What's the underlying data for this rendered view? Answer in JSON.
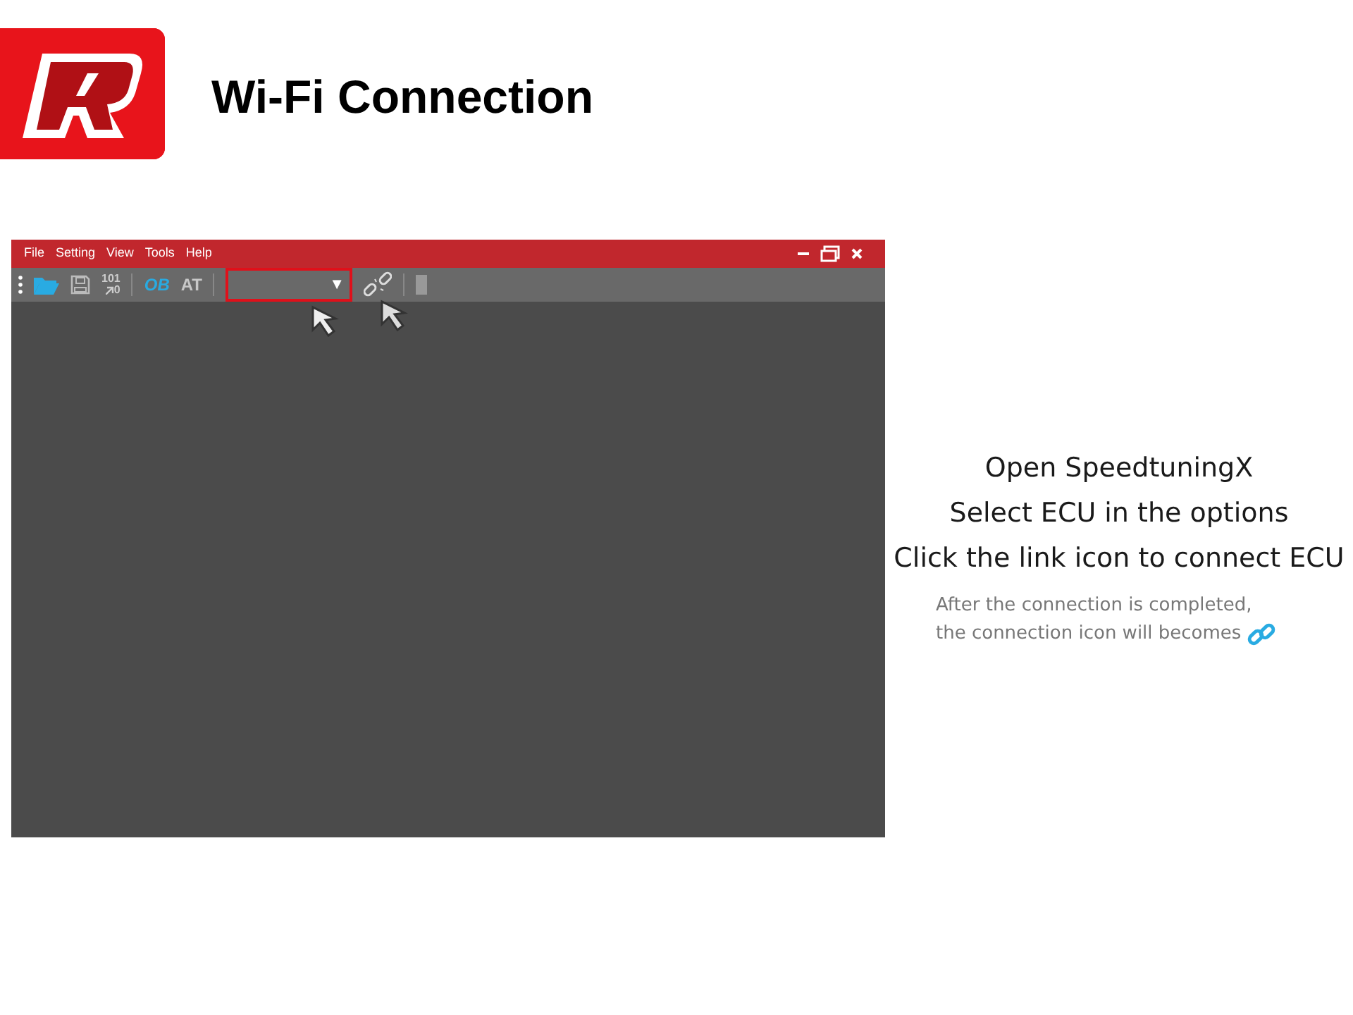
{
  "slide": {
    "title": "Wi-Fi Connection"
  },
  "window": {
    "menu": [
      "File",
      "Setting",
      "View",
      "Tools",
      "Help"
    ],
    "toolbar": [
      {
        "kind": "open"
      },
      {
        "kind": "save"
      },
      {
        "kind": "convert",
        "label": "101",
        "sub": "0"
      },
      {
        "kind": "sep"
      },
      {
        "kind": "text",
        "label": "OB",
        "color": "#29abe2"
      },
      {
        "kind": "text",
        "label": "AT",
        "color": "#c8c8c8"
      },
      {
        "kind": "sep"
      },
      {
        "kind": "dropdown",
        "arrow": "▼",
        "highlighted": true
      },
      {
        "kind": "link",
        "connected": false
      },
      {
        "kind": "sep"
      },
      {
        "kind": "block"
      }
    ]
  },
  "instructions": [
    "Open SpeedtuningX",
    "Select ECU in the options",
    "Click the link icon to connect ECU"
  ],
  "note": [
    "After the connection is completed,",
    "the connection icon will becomes"
  ]
}
